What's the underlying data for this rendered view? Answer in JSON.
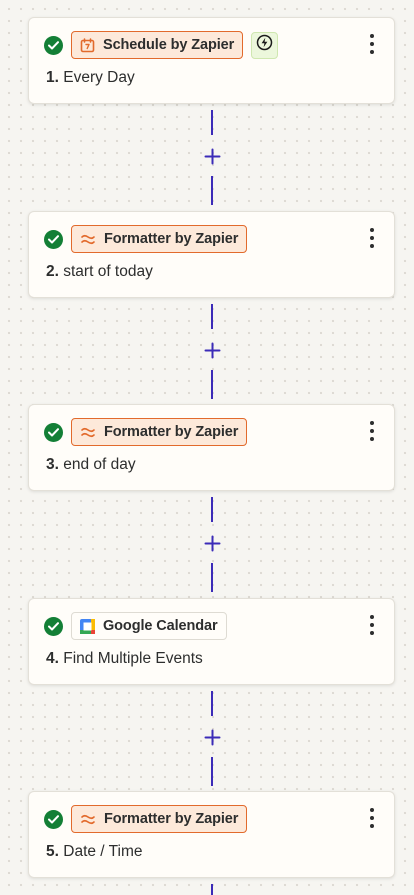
{
  "steps": [
    {
      "number": "1.",
      "title": "Every Day",
      "app": "Schedule by Zapier",
      "app_icon": "calendar-icon",
      "trigger": true
    },
    {
      "number": "2.",
      "title": "start of today",
      "app": "Formatter by Zapier",
      "app_icon": "formatter-icon"
    },
    {
      "number": "3.",
      "title": "end of day",
      "app": "Formatter by Zapier",
      "app_icon": "formatter-icon"
    },
    {
      "number": "4.",
      "title": "Find Multiple Events",
      "app": "Google Calendar",
      "app_icon": "google-calendar-icon"
    },
    {
      "number": "5.",
      "title": "Date / Time",
      "app": "Formatter by Zapier",
      "app_icon": "formatter-icon"
    }
  ],
  "colors": {
    "success": "#137f36",
    "zapier_orange": "#e26a2c",
    "zapier_badge_bg": "#fde9da",
    "connector": "#3b2bb8",
    "trigger_bg": "#ecf7dc"
  },
  "icons": {
    "status": "check-icon",
    "menu": "more-vertical-icon",
    "add": "plus-icon",
    "trigger": "lightning-icon"
  }
}
